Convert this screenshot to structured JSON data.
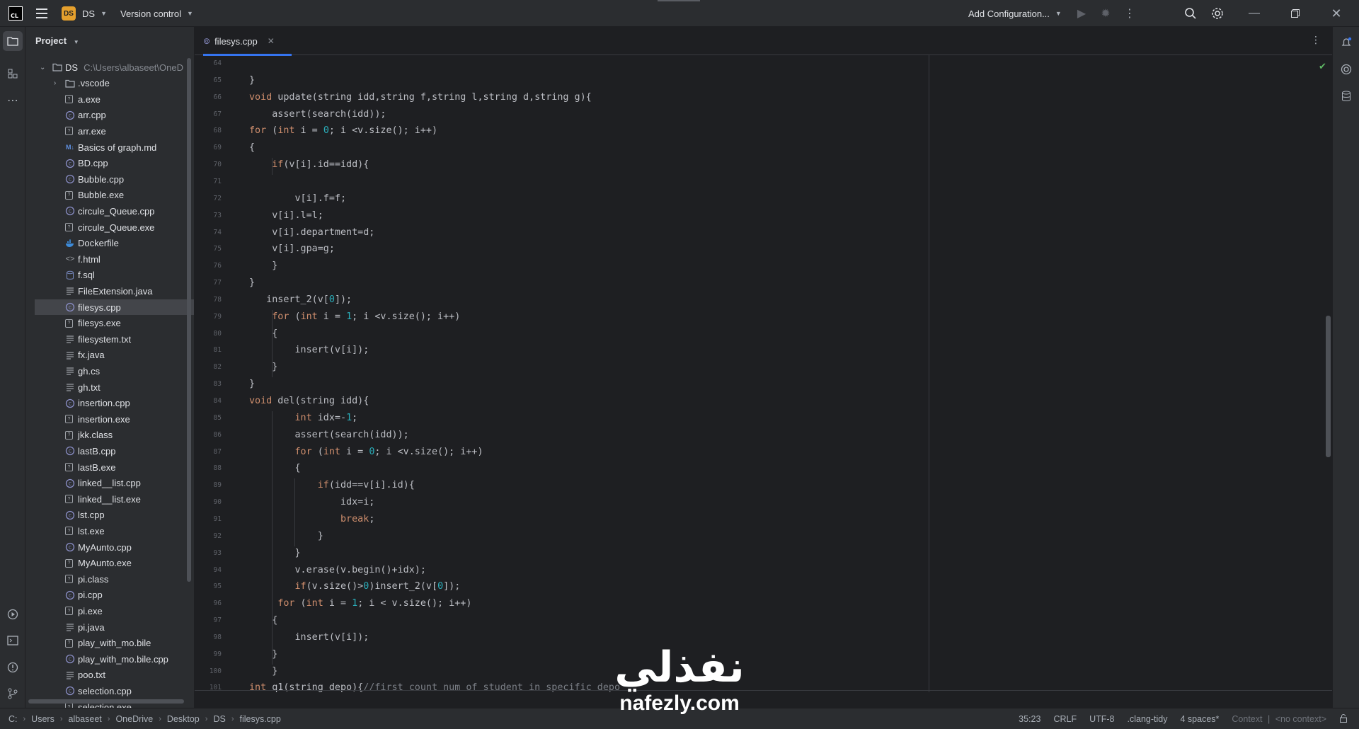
{
  "titlebar": {
    "project_badge": "DS",
    "project_name": "DS",
    "version_control": "Version control",
    "add_configuration": "Add Configuration..."
  },
  "project_panel": {
    "title": "Project",
    "root": {
      "name": "DS",
      "path": "C:\\Users\\albaseet\\OneD"
    },
    "items": [
      {
        "name": ".vscode",
        "type": "folder"
      },
      {
        "name": "a.exe",
        "type": "exe"
      },
      {
        "name": "arr.cpp",
        "type": "cpp"
      },
      {
        "name": "arr.exe",
        "type": "exe"
      },
      {
        "name": "Basics of graph.md",
        "type": "md"
      },
      {
        "name": "BD.cpp",
        "type": "cpp"
      },
      {
        "name": "Bubble.cpp",
        "type": "cpp"
      },
      {
        "name": "Bubble.exe",
        "type": "exe"
      },
      {
        "name": "circule_Queue.cpp",
        "type": "cpp"
      },
      {
        "name": "circule_Queue.exe",
        "type": "exe"
      },
      {
        "name": "Dockerfile",
        "type": "docker"
      },
      {
        "name": "f.html",
        "type": "html"
      },
      {
        "name": "f.sql",
        "type": "sql"
      },
      {
        "name": "FileExtension.java",
        "type": "txt"
      },
      {
        "name": "filesys.cpp",
        "type": "cpp",
        "selected": true
      },
      {
        "name": "filesys.exe",
        "type": "exe"
      },
      {
        "name": "filesystem.txt",
        "type": "txt"
      },
      {
        "name": "fx.java",
        "type": "txt"
      },
      {
        "name": "gh.cs",
        "type": "txt"
      },
      {
        "name": "gh.txt",
        "type": "txt"
      },
      {
        "name": "insertion.cpp",
        "type": "cpp"
      },
      {
        "name": "insertion.exe",
        "type": "exe"
      },
      {
        "name": "jkk.class",
        "type": "exe"
      },
      {
        "name": "lastB.cpp",
        "type": "cpp"
      },
      {
        "name": "lastB.exe",
        "type": "exe"
      },
      {
        "name": "linked__list.cpp",
        "type": "cpp"
      },
      {
        "name": "linked__list.exe",
        "type": "exe"
      },
      {
        "name": "lst.cpp",
        "type": "cpp"
      },
      {
        "name": "lst.exe",
        "type": "exe"
      },
      {
        "name": "MyAunto.cpp",
        "type": "cpp"
      },
      {
        "name": "MyAunto.exe",
        "type": "exe"
      },
      {
        "name": "pi.class",
        "type": "exe"
      },
      {
        "name": "pi.cpp",
        "type": "cpp"
      },
      {
        "name": "pi.exe",
        "type": "exe"
      },
      {
        "name": "pi.java",
        "type": "txt"
      },
      {
        "name": "play_with_mo.bile",
        "type": "exe"
      },
      {
        "name": "play_with_mo.bile.cpp",
        "type": "cpp"
      },
      {
        "name": "poo.txt",
        "type": "txt"
      },
      {
        "name": "selection.cpp",
        "type": "cpp"
      },
      {
        "name": "selection.exe",
        "type": "exe"
      }
    ]
  },
  "editor": {
    "tab": "filesys.cpp",
    "line_numbers": [
      "64",
      "65",
      "66",
      "67",
      "68",
      "69",
      "70",
      "71",
      "72",
      "73",
      "74",
      "75",
      "76",
      "77",
      "78",
      "79",
      "80",
      "81",
      "82",
      "83",
      "84",
      "85",
      "86",
      "87",
      "88",
      "89",
      "90",
      "91",
      "92",
      "93",
      "94",
      "95",
      "96",
      "97",
      "98",
      "99",
      "100",
      "101"
    ],
    "lines": [
      "",
      "}",
      "void update(string idd,string f,string l,string d,string g){",
      "    assert(search(idd));",
      "for (int i = 0; i <v.size(); i++)",
      "{",
      "    if(v[i].id==idd){",
      "",
      "        v[i].f=f;",
      "    v[i].l=l;",
      "    v[i].department=d;",
      "    v[i].gpa=g;",
      "    }",
      "}",
      "   insert_2(v[0]);",
      "    for (int i = 1; i <v.size(); i++)",
      "    {",
      "        insert(v[i]);",
      "    }",
      "}",
      "void del(string idd){",
      "        int idx=-1;",
      "        assert(search(idd));",
      "        for (int i = 0; i <v.size(); i++)",
      "        {",
      "            if(idd==v[i].id){",
      "                idx=i;",
      "                break;",
      "            }",
      "        }",
      "        v.erase(v.begin()+idx);",
      "        if(v.size()>0)insert_2(v[0]);",
      "     for (int i = 1; i < v.size(); i++)",
      "    {",
      "        insert(v[i]);",
      "    }",
      "    }",
      "int q1(string depo){//first count num of student in specific depo"
    ]
  },
  "statusbar": {
    "crumbs": [
      "C:",
      "Users",
      "albaseet",
      "OneDrive",
      "Desktop",
      "DS",
      "filesys.cpp"
    ],
    "position": "35:23",
    "line_ending": "CRLF",
    "encoding": "UTF-8",
    "linter": ".clang-tidy",
    "indent": "4 spaces*",
    "context_label": "Context",
    "context_value": "<no context>"
  },
  "watermark": {
    "arabic": "نفذلي",
    "site": "nafezly.com"
  }
}
